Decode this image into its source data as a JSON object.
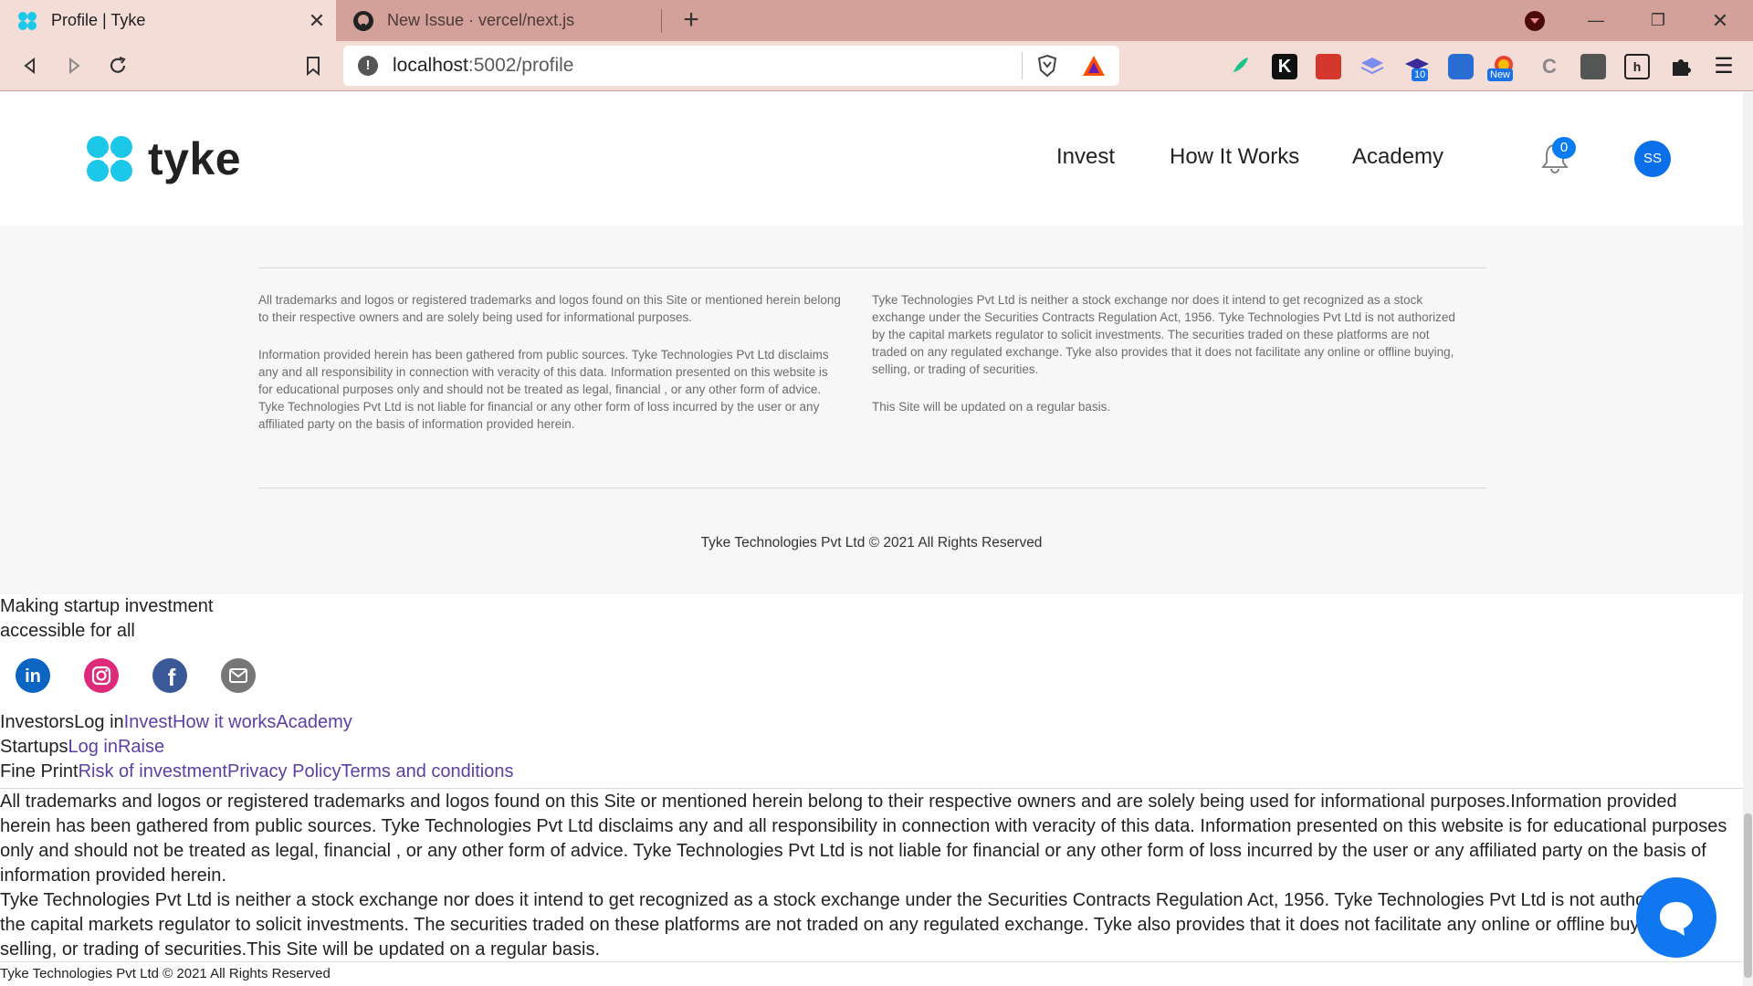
{
  "browser": {
    "tabs": [
      {
        "title": "Profile | Tyke",
        "active": true
      },
      {
        "title": "New Issue · vercel/next.js",
        "active": false
      }
    ],
    "url_host": "localhost",
    "url_path": ":5002/profile",
    "extension_badges": {
      "count": "10",
      "new": "New"
    }
  },
  "header": {
    "logo_text": "tyke",
    "nav": [
      "Invest",
      "How It Works",
      "Academy"
    ],
    "notification_count": "0",
    "avatar_initials": "SS"
  },
  "disclaimer": {
    "left": [
      "All trademarks and logos or registered trademarks and logos found on this Site or mentioned herein belong to their respective owners and are solely being used for informational purposes.",
      "Information provided herein has been gathered from public sources. Tyke Technologies Pvt Ltd disclaims any and all responsibility in connection with veracity of this data. Information presented on this website is for educational purposes only and should not be treated as legal, financial , or any other form of advice. Tyke Technologies Pvt Ltd is not liable for financial or any other form of loss incurred by the user or any affiliated party on the basis of information provided herein."
    ],
    "right": [
      "Tyke Technologies Pvt Ltd is neither a stock exchange nor does it intend to get recognized as a stock exchange under the Securities Contracts Regulation Act, 1956. Tyke Technologies Pvt Ltd is not authorized by the capital markets regulator to solicit investments. The securities traded on these platforms are not traded on any regulated exchange. Tyke also provides that it does not facilitate any online or offline buying, selling, or trading of securities.",
      "This Site will be updated on a regular basis."
    ],
    "copyright": "Tyke Technologies Pvt Ltd © 2021 All Rights Reserved"
  },
  "fallback_footer": {
    "tagline_line1": "Making startup investment",
    "tagline_line2": "accessible for all",
    "social": [
      "linkedin",
      "instagram",
      "facebook",
      "email"
    ],
    "investors": {
      "label": "Investors",
      "plain": "Log in",
      "links": [
        "Invest",
        "How it works",
        "Academy"
      ]
    },
    "startups": {
      "label": "Startups",
      "links": [
        "Log in",
        "Raise"
      ]
    },
    "fine_print": {
      "label": "Fine Print",
      "links": [
        "Risk of investment",
        "Privacy Policy",
        "Terms and conditions"
      ]
    },
    "paragraph1": "All trademarks and logos or registered trademarks and logos found on this Site or mentioned herein belong to their respective owners and are solely being used for informational purposes.Information provided herein has been gathered from public sources. Tyke Technologies Pvt Ltd disclaims any and all responsibility in connection with veracity of this data. Information presented on this website is for educational purposes only and should not be treated as legal, financial , or any other form of advice. Tyke Technologies Pvt Ltd is not liable for financial or any other form of loss incurred by the user or any affiliated party on the basis of information provided herein.",
    "paragraph2": "Tyke Technologies Pvt Ltd is neither a stock exchange nor does it intend to get recognized as a stock exchange under the Securities Contracts Regulation Act, 1956. Tyke Technologies Pvt Ltd is not authorized by the capital markets regulator to solicit investments. The securities traded on these platforms are not traded on any regulated exchange. Tyke also provides that it does not facilitate any online or offline buying, selling, or trading of securities.This Site will be updated on a regular basis.",
    "copyright": "Tyke Technologies Pvt Ltd © 2021 All Rights Reserved"
  },
  "colors": {
    "brand_cyan": "#1cc8e8",
    "link_purple": "#5b3fa3",
    "accent_blue": "#0a6fe8"
  }
}
